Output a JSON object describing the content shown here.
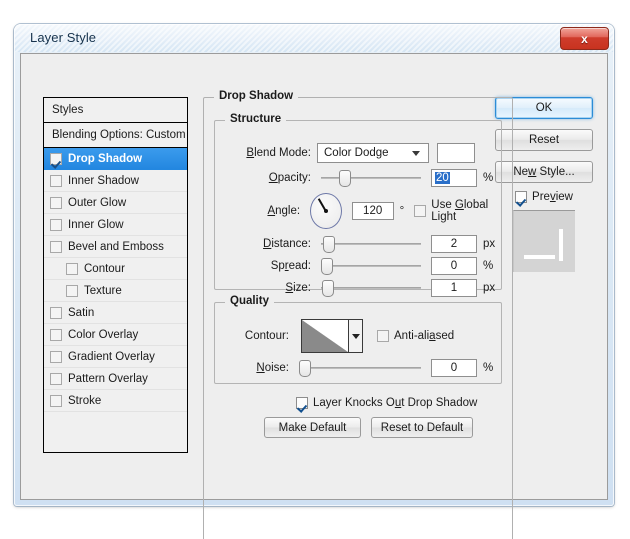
{
  "window": {
    "title": "Layer Style",
    "close_label": "x"
  },
  "styles_panel": {
    "styles_label": "Styles",
    "blending_options_label": "Blending Options: Custom",
    "effects": [
      {
        "label": "Drop Shadow",
        "checked": true,
        "selected": true,
        "indent": false
      },
      {
        "label": "Inner Shadow",
        "checked": false,
        "selected": false,
        "indent": false
      },
      {
        "label": "Outer Glow",
        "checked": false,
        "selected": false,
        "indent": false
      },
      {
        "label": "Inner Glow",
        "checked": false,
        "selected": false,
        "indent": false
      },
      {
        "label": "Bevel and Emboss",
        "checked": false,
        "selected": false,
        "indent": false
      },
      {
        "label": "Contour",
        "checked": false,
        "selected": false,
        "indent": true
      },
      {
        "label": "Texture",
        "checked": false,
        "selected": false,
        "indent": true
      },
      {
        "label": "Satin",
        "checked": false,
        "selected": false,
        "indent": false
      },
      {
        "label": "Color Overlay",
        "checked": false,
        "selected": false,
        "indent": false
      },
      {
        "label": "Gradient Overlay",
        "checked": false,
        "selected": false,
        "indent": false
      },
      {
        "label": "Pattern Overlay",
        "checked": false,
        "selected": false,
        "indent": false
      },
      {
        "label": "Stroke",
        "checked": false,
        "selected": false,
        "indent": false
      }
    ]
  },
  "main": {
    "group_title": "Drop Shadow",
    "structure": {
      "title": "Structure",
      "blend_mode_label": "Blend Mode:",
      "blend_mode_value": "Color Dodge",
      "color_swatch": "#ffffff",
      "opacity_label": "Opacity:",
      "opacity_value": "20",
      "opacity_unit": "%",
      "opacity_percent": 20,
      "angle_label": "Angle:",
      "angle_value": "120",
      "angle_unit": "°",
      "use_global_light_label": "Use Global Light",
      "use_global_light_checked": false,
      "distance_label": "Distance:",
      "distance_value": "2",
      "distance_unit": "px",
      "distance_percent": 2,
      "spread_label": "Spread:",
      "spread_value": "0",
      "spread_unit": "%",
      "spread_percent": 0,
      "size_label": "Size:",
      "size_value": "1",
      "size_unit": "px",
      "size_percent": 1
    },
    "quality": {
      "title": "Quality",
      "contour_label": "Contour:",
      "anti_aliased_label": "Anti-aliased",
      "anti_aliased_checked": false,
      "noise_label": "Noise:",
      "noise_value": "0",
      "noise_unit": "%",
      "noise_percent": 0
    },
    "knocks_out_label": "Layer Knocks Out Drop Shadow",
    "knocks_out_checked": true,
    "make_default_label": "Make Default",
    "reset_default_label": "Reset to Default"
  },
  "right_panel": {
    "ok_label": "OK",
    "reset_label": "Reset",
    "new_style_label": "New Style...",
    "preview_label": "Preview",
    "preview_checked": true
  },
  "colors": {
    "accent_selected": "#2387e0",
    "dialog_bg": "#eeeeee",
    "title_bar": "#e4eef8",
    "close_red": "#cf3c2c"
  }
}
